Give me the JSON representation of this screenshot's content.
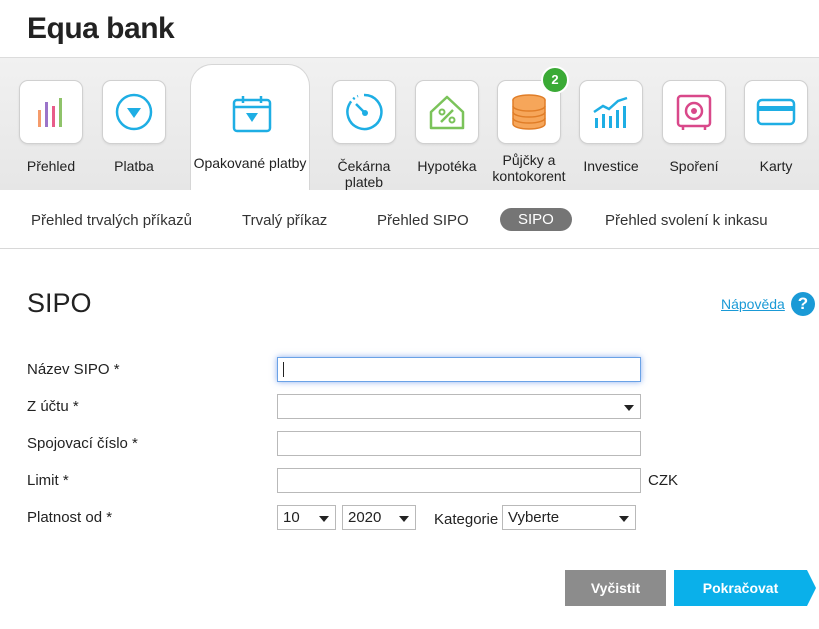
{
  "logo": {
    "text": "Equa bank"
  },
  "nav": {
    "items": [
      {
        "label": "Přehled",
        "icon": "bar-chart-icon"
      },
      {
        "label": "Platba",
        "icon": "payment-arrow-icon"
      },
      {
        "label": "Opakované platby",
        "icon": "calendar-icon",
        "active": true
      },
      {
        "label": "Čekárna plateb",
        "icon": "clock-gauge-icon"
      },
      {
        "label": "Hypotéka",
        "icon": "house-percent-icon"
      },
      {
        "label": "Půjčky a kontokorent",
        "icon": "coins-icon",
        "badge": "2"
      },
      {
        "label": "Investice",
        "icon": "growth-chart-icon"
      },
      {
        "label": "Spoření",
        "icon": "safe-icon"
      },
      {
        "label": "Karty",
        "icon": "card-icon"
      }
    ]
  },
  "subnav": {
    "items": [
      {
        "label": "Přehled trvalých příkazů"
      },
      {
        "label": "Trvalý příkaz"
      },
      {
        "label": "Přehled SIPO"
      },
      {
        "label": "SIPO",
        "active": true
      },
      {
        "label": "Přehled svolení k inkasu"
      }
    ]
  },
  "page": {
    "title": "SIPO",
    "help_link": "Nápověda",
    "help_icon": "?"
  },
  "form": {
    "name_label": "Název SIPO *",
    "name_value": "",
    "account_label": "Z účtu *",
    "account_value": "",
    "connection_label": "Spojovací číslo *",
    "connection_value": "",
    "limit_label": "Limit *",
    "limit_value": "",
    "limit_unit": "CZK",
    "valid_label": "Platnost od *",
    "valid_month": "10",
    "valid_year": "2020",
    "category_label": "Kategorie",
    "category_value": "Vyberte"
  },
  "buttons": {
    "clear": "Vyčistit",
    "next": "Pokračovat"
  },
  "colors": {
    "accent": "#0ab0ea",
    "help_blue": "#1a9ad6",
    "badge_green": "#3aaa35",
    "active_subnav": "#757575",
    "clear_button": "#8c8c8c"
  }
}
